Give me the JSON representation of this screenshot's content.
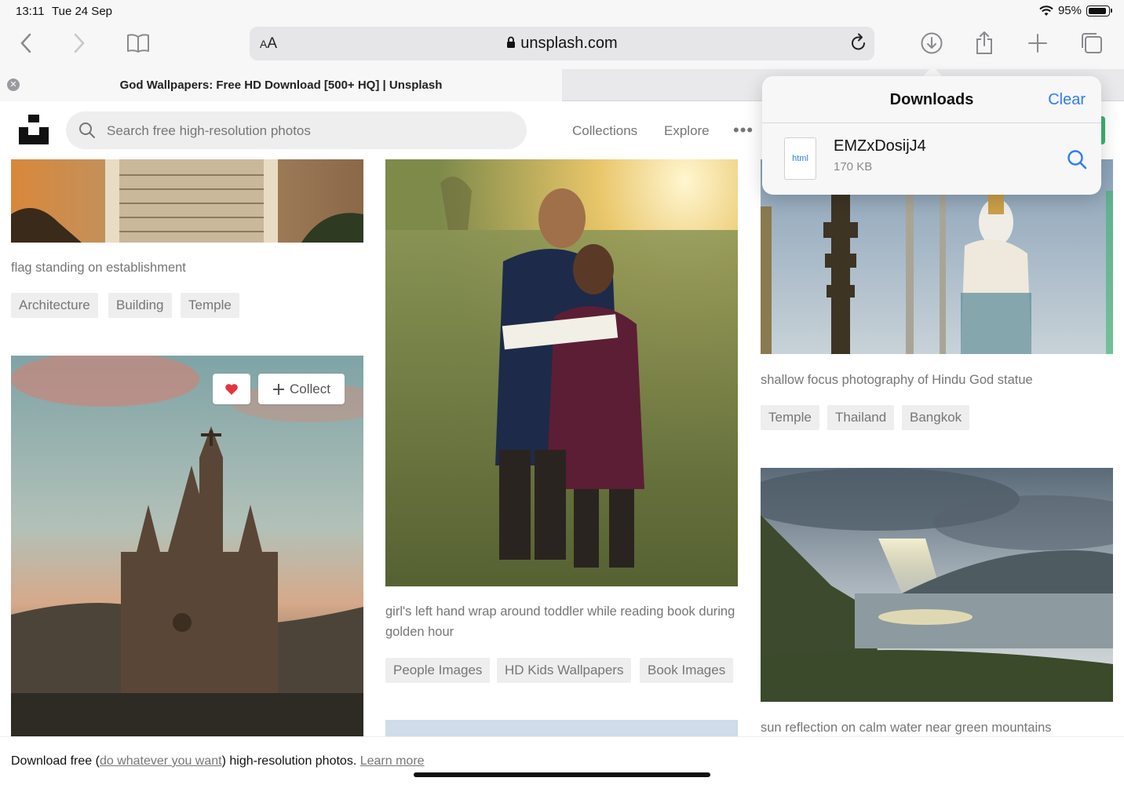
{
  "status_bar": {
    "time": "13:11",
    "date": "Tue 24 Sep",
    "battery": "95%",
    "battery_level": 0.95
  },
  "browser": {
    "address_aa": "AA",
    "url": "unsplash.com",
    "tab_title": "God Wallpapers: Free HD Download [500+ HQ] | Unsplash"
  },
  "downloads": {
    "title": "Downloads",
    "clear_label": "Clear",
    "items": [
      {
        "name": "EMZxDosijJ4",
        "size": "170 KB",
        "type": "html"
      }
    ]
  },
  "site": {
    "search_placeholder": "Search free high-resolution photos",
    "nav": [
      "Collections",
      "Explore"
    ],
    "more": "•••"
  },
  "photos": {
    "col1_top": {
      "caption": "flag standing on establishment",
      "tags": [
        "Architecture",
        "Building",
        "Temple"
      ]
    },
    "col1_card": {
      "collect_label": "Collect"
    },
    "col2_top": {
      "caption": "girl's left hand wrap around toddler while reading book during golden hour",
      "tags": [
        "People Images",
        "HD Kids Wallpapers",
        "Book Images"
      ]
    },
    "col3_top": {
      "caption": "shallow focus photography of Hindu God statue",
      "tags": [
        "Temple",
        "Thailand",
        "Bangkok"
      ]
    },
    "col3_second": {
      "caption": "sun reflection on calm water near green mountains"
    }
  },
  "footer": {
    "prefix": "Download free (",
    "link1": "do whatever you want",
    "middle": ") high-resolution photos. ",
    "link2": "Learn more"
  }
}
